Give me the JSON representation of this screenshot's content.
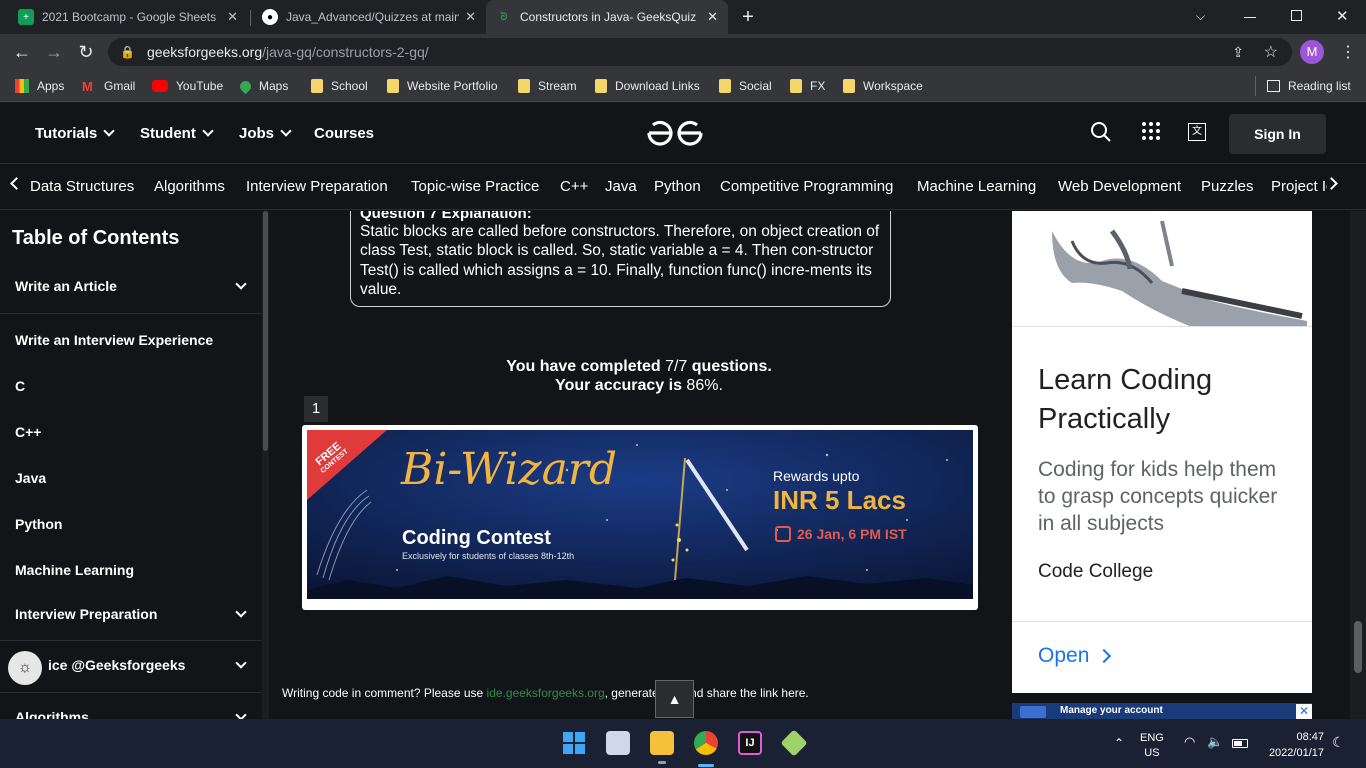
{
  "browser": {
    "tabs": [
      {
        "title": "2021 Bootcamp - Google Sheets",
        "icon": "sheets-icon",
        "color": "#0f9d58"
      },
      {
        "title": "Java_Advanced/Quizzes at main",
        "icon": "github-icon",
        "color": "#ffffff"
      },
      {
        "title": "Constructors in Java- GeeksQuiz",
        "icon": "gfg-icon",
        "color": "#2f8d46"
      }
    ],
    "new_tab_glyph": "+",
    "url_host": "geeksforgeeks.org",
    "url_path": "/java-gq/constructors-2-gq/",
    "profile_initial": "M",
    "bookmarks": [
      {
        "label": "Apps",
        "type": "apps"
      },
      {
        "label": "Gmail",
        "type": "gmail"
      },
      {
        "label": "YouTube",
        "type": "youtube"
      },
      {
        "label": "Maps",
        "type": "maps"
      },
      {
        "label": "School",
        "type": "folder"
      },
      {
        "label": "Website Portfolio",
        "type": "folder"
      },
      {
        "label": "Stream",
        "type": "folder"
      },
      {
        "label": "Download Links",
        "type": "folder"
      },
      {
        "label": "Social",
        "type": "folder"
      },
      {
        "label": "FX",
        "type": "folder"
      },
      {
        "label": "Workspace",
        "type": "folder"
      }
    ],
    "reading_list": "Reading list"
  },
  "header": {
    "menus": [
      "Tutorials",
      "Student",
      "Jobs",
      "Courses"
    ],
    "logo": "GfG",
    "sign_in": "Sign In"
  },
  "subnav": [
    "Data Structures",
    "Algorithms",
    "Interview Preparation",
    "Topic-wise Practice",
    "C++",
    "Java",
    "Python",
    "Competitive Programming",
    "Machine Learning",
    "Web Development",
    "Puzzles",
    "Project Ideas"
  ],
  "sidebar": {
    "title": "Table of Contents",
    "items": [
      {
        "label": "Write an Article",
        "chevron": true
      },
      {
        "label": "Write an Interview Experience",
        "chevron": false
      },
      {
        "label": "C",
        "chevron": false
      },
      {
        "label": "C++",
        "chevron": false
      },
      {
        "label": "Java",
        "chevron": false
      },
      {
        "label": "Python",
        "chevron": false
      },
      {
        "label": "Machine Learning",
        "chevron": false
      },
      {
        "label": "Interview Preparation",
        "chevron": true
      },
      {
        "label": "ice @Geeksforgeeks",
        "chevron": true
      },
      {
        "label": "Algorithms",
        "chevron": true
      }
    ]
  },
  "main": {
    "explanation_heading": "Question 7 Explanation:",
    "explanation": "Static blocks are called before constructors. Therefore, on object creation of class Test, static block is called. So, static variable a = 4. Then con-structor Test() is called which assigns a = 10. Finally, function func() incre-ments its value.",
    "completed_prefix": "You have completed ",
    "completed_value": "7/7",
    "completed_suffix": " questions.",
    "accuracy_prefix": "Your accuracy is ",
    "accuracy_value": "86%",
    "accuracy_suffix": ".",
    "question_number": "1",
    "banner": {
      "ribbon_line1": "FREE",
      "ribbon_line2": "CONTEST",
      "title": "Bi-Wizard",
      "subtitle": "Coding Contest",
      "eligibility": "Exclusively for students of classes 8th-12th",
      "rewards_label": "Rewards upto",
      "rewards_value": "INR 5 Lacs",
      "date": "26 Jan, 6 PM IST"
    },
    "comment_prefix": "Writing code in comment? Please use ",
    "comment_link": "ide.geeksforgeeks.org",
    "comment_suffix": ", generate link and share the link here.",
    "scroll_top_glyph": "▲"
  },
  "ad": {
    "headline": "Learn Coding Practically",
    "body": "Coding for kids help them to grasp concepts quicker in all subjects",
    "advertiser": "Code College",
    "cta": "Open",
    "footer_text": "Manage your account"
  },
  "taskbar": {
    "lang_line1": "ENG",
    "lang_line2": "US",
    "time": "08:47",
    "date": "2022/01/17"
  }
}
